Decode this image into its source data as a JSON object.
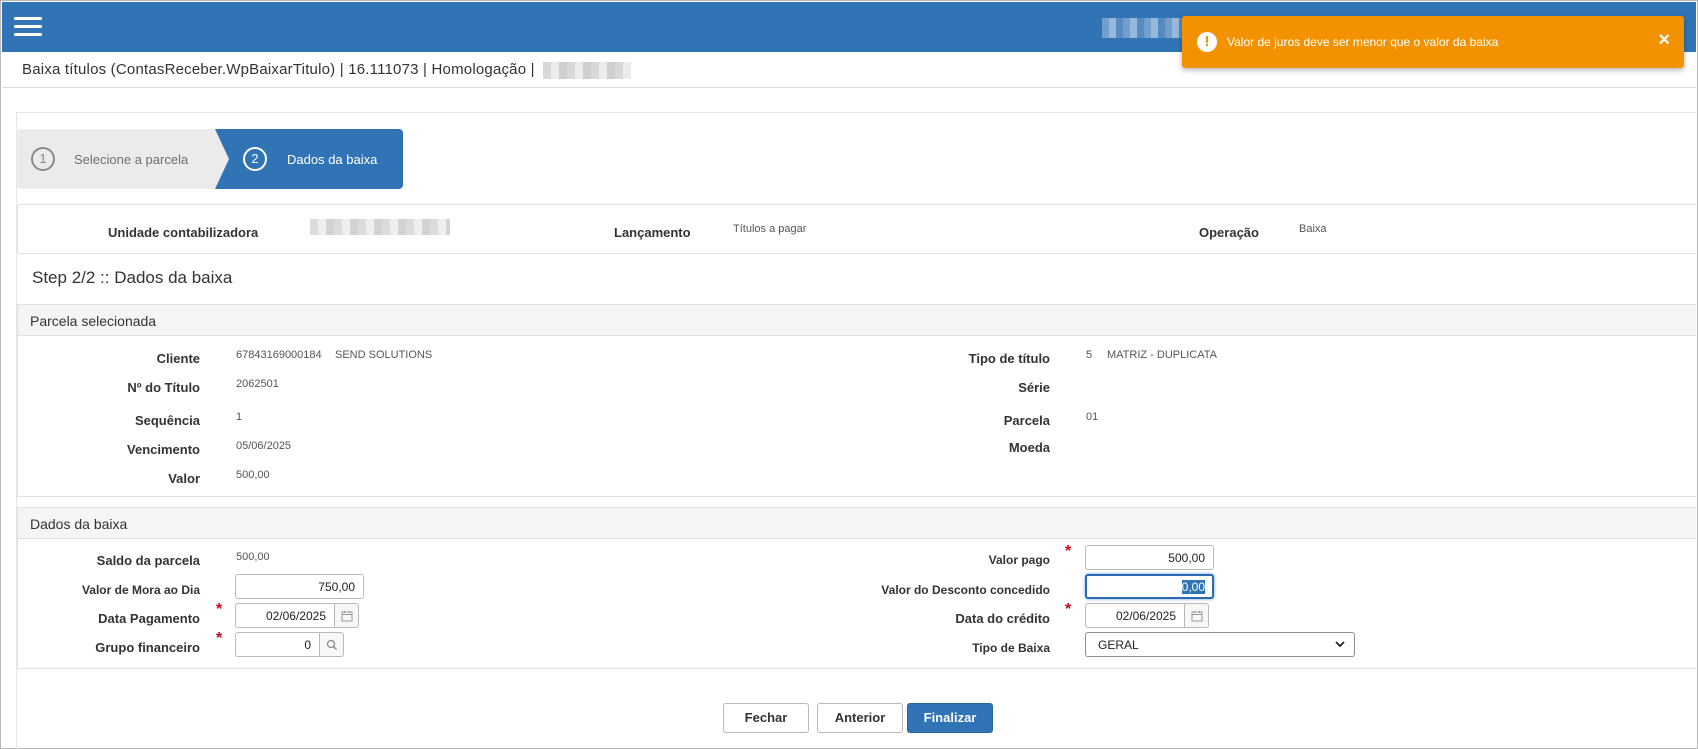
{
  "header": {
    "breadcrumb": "Baixa títulos (ContasReceber.WpBaixarTitulo) | 16.111073 | Homologação |"
  },
  "toast": {
    "message": "Valor de juros deve ser menor que o valor da baixa",
    "icon": "!",
    "close": "×",
    "color": "#f39200"
  },
  "wizard": {
    "steps": [
      {
        "number": "1",
        "label": "Selecione a parcela"
      },
      {
        "number": "2",
        "label": "Dados da baixa"
      }
    ],
    "active_color": "#3174b5"
  },
  "info": {
    "unidade_label": "Unidade contabilizadora",
    "lancamento_label": "Lançamento",
    "lancamento_value": "Títulos a pagar",
    "operacao_label": "Operação",
    "operacao_value": "Baixa"
  },
  "step_title": "Step 2/2 :: Dados da baixa",
  "parcela": {
    "title": "Parcela selecionada",
    "cliente_label": "Cliente",
    "cliente_code": "67843169000184",
    "cliente_name": "SEND SOLUTIONS",
    "titulo_label": "Nº do Título",
    "titulo_value": "2062501",
    "sequencia_label": "Sequência",
    "sequencia_value": "1",
    "vencimento_label": "Vencimento",
    "vencimento_value": "05/06/2025",
    "valor_label": "Valor",
    "valor_value": "500,00",
    "tipo_label": "Tipo de título",
    "tipo_code": "5",
    "tipo_name": "MATRIZ - DUPLICATA",
    "serie_label": "Série",
    "parcela_label": "Parcela",
    "parcela_value": "01",
    "moeda_label": "Moeda"
  },
  "baixa": {
    "title": "Dados da baixa",
    "saldo_label": "Saldo da parcela",
    "saldo_value": "500,00",
    "mora_label": "Valor de Mora ao Dia",
    "mora_value": "750,00",
    "data_pag_label": "Data Pagamento",
    "data_pag_value": "02/06/2025",
    "grupo_label": "Grupo financeiro",
    "grupo_value": "0",
    "valor_pago_label": "Valor pago",
    "valor_pago_value": "500,00",
    "desconto_label": "Valor do Desconto concedido",
    "desconto_value": "0,00",
    "data_credito_label": "Data do crédito",
    "data_credito_value": "02/06/2025",
    "tipo_baixa_label": "Tipo de Baixa",
    "tipo_baixa_value": "GERAL",
    "required_mark": "*"
  },
  "buttons": {
    "fechar": "Fechar",
    "anterior": "Anterior",
    "finalizar": "Finalizar"
  }
}
